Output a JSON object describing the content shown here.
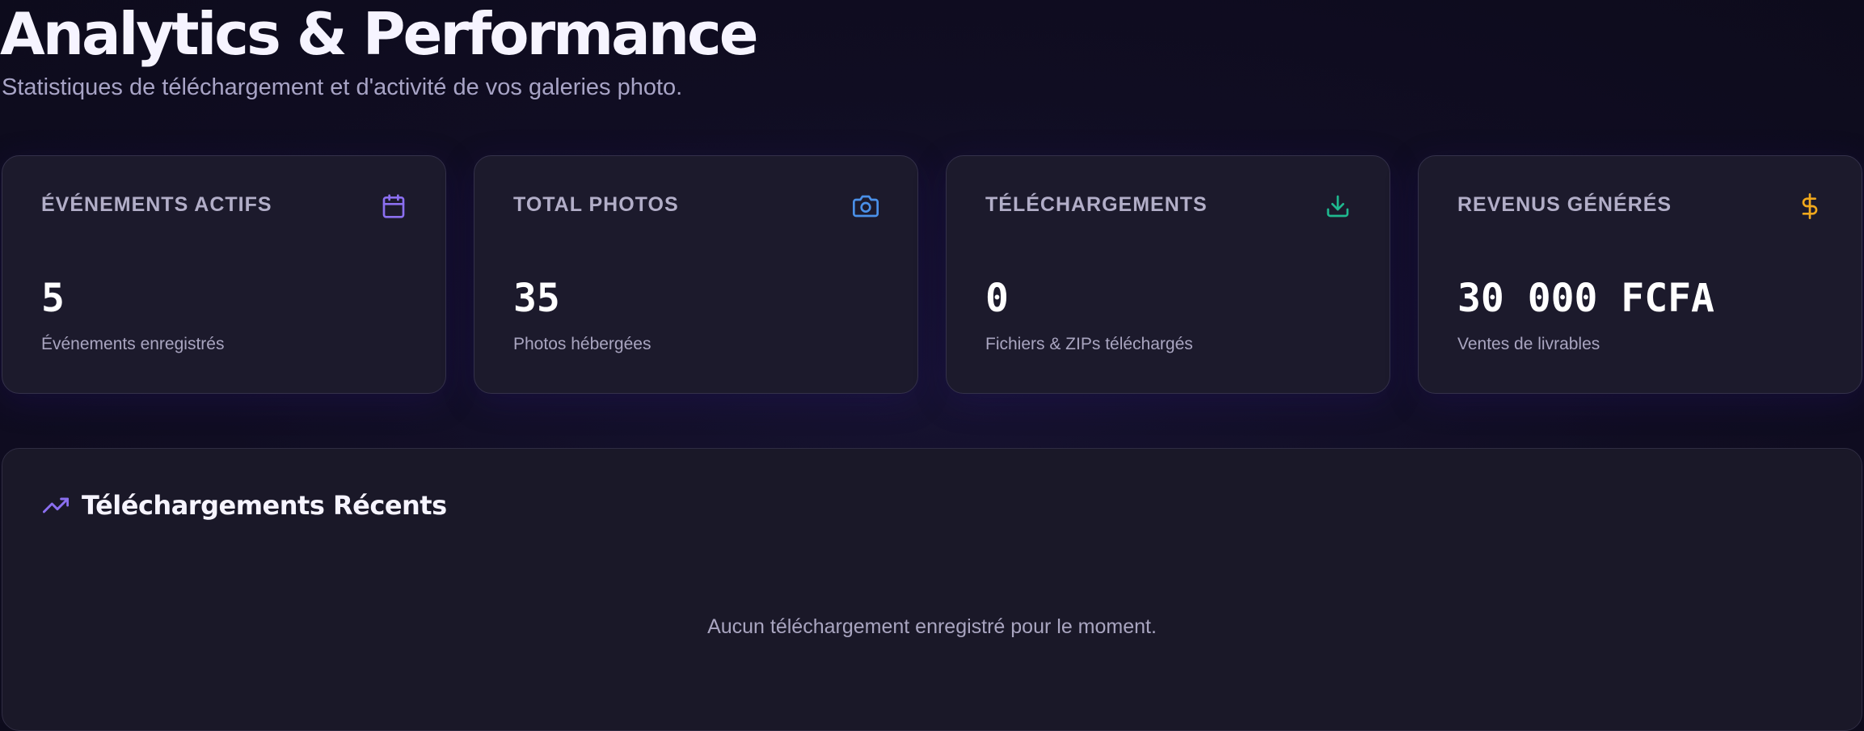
{
  "header": {
    "title": "Analytics & Performance",
    "subtitle": "Statistiques de téléchargement et d'activité de vos galeries photo."
  },
  "stats": [
    {
      "label": "ÉVÉNEMENTS ACTIFS",
      "value": "5",
      "caption": "Événements enregistrés",
      "icon": "calendar-icon",
      "icon_color": "#8b6ff0"
    },
    {
      "label": "TOTAL PHOTOS",
      "value": "35",
      "caption": "Photos hébergées",
      "icon": "camera-icon",
      "icon_color": "#4a90e8"
    },
    {
      "label": "TÉLÉCHARGEMENTS",
      "value": "0",
      "caption": "Fichiers & ZIPs téléchargés",
      "icon": "download-icon",
      "icon_color": "#1fb88f"
    },
    {
      "label": "REVENUS GÉNÉRÉS",
      "value": "30 000 FCFA",
      "caption": "Ventes de livrables",
      "icon": "dollar-icon",
      "icon_color": "#f0a81c"
    }
  ],
  "recent": {
    "title": "Téléchargements Récents",
    "icon": "trending-up-icon",
    "icon_color": "#8b6ff0",
    "empty_message": "Aucun téléchargement enregistré pour le moment."
  },
  "colors": {
    "background": "#100d22",
    "card_background": "#1c1a2c",
    "card_border": "#34314a",
    "text_primary": "#f6f4ff",
    "text_secondary": "#a9a5c0"
  }
}
